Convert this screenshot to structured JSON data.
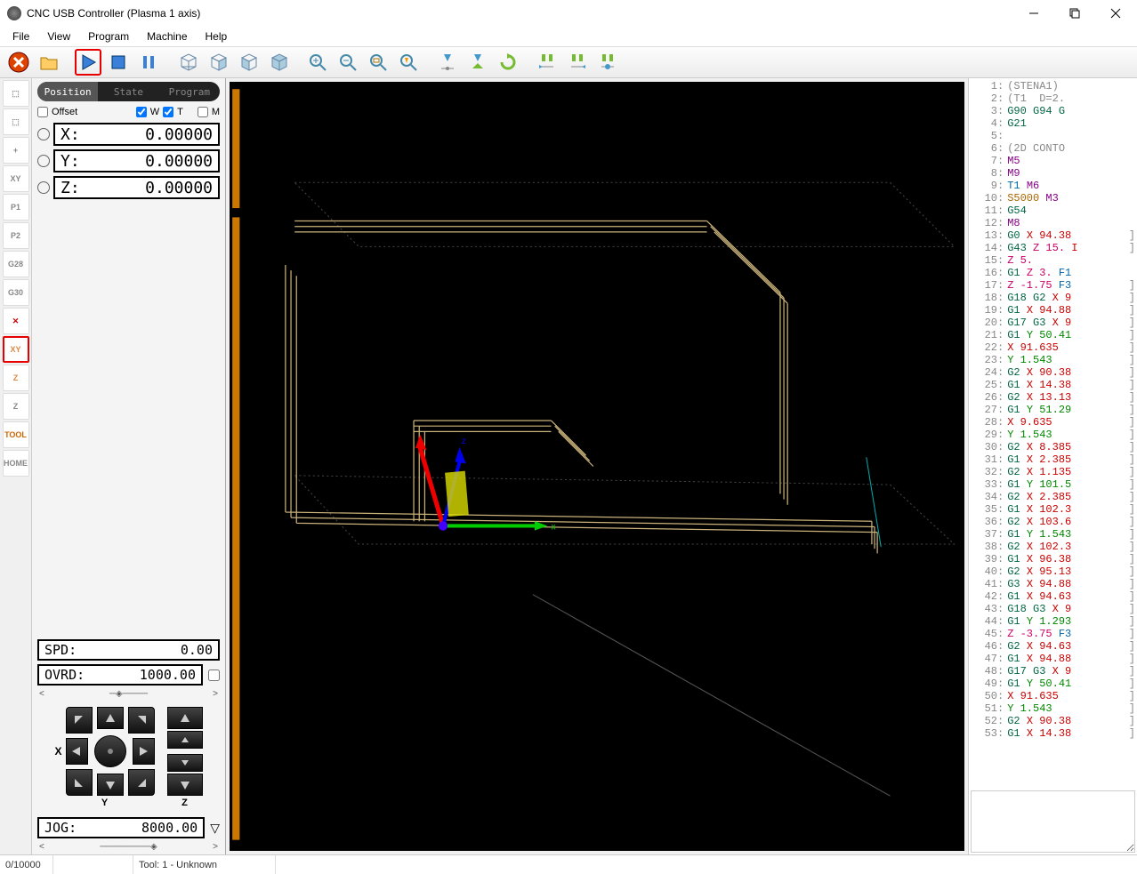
{
  "window": {
    "title": "CNC USB Controller (Plasma 1 axis)"
  },
  "menu": [
    "File",
    "View",
    "Program",
    "Machine",
    "Help"
  ],
  "tabs": {
    "position": "Position",
    "state": "State",
    "program": "Program"
  },
  "offset": {
    "label": "Offset",
    "w": "W",
    "t": "T",
    "m": "M"
  },
  "coords": {
    "x": {
      "axis": "X:",
      "val": "0.00000"
    },
    "y": {
      "axis": "Y:",
      "val": "0.00000"
    },
    "z": {
      "axis": "Z:",
      "val": "0.00000"
    }
  },
  "spd": {
    "label": "SPD:",
    "val": "0.00"
  },
  "ovrd": {
    "label": "OVRD:",
    "val": "1000.00"
  },
  "jog": {
    "label": "JOG:",
    "val": "8000.00",
    "xlabel": "X",
    "ylabel": "Y",
    "zlabel": "Z"
  },
  "rail": [
    "",
    "",
    "+",
    "XY",
    "P1",
    "P2",
    "G28",
    "G30",
    "✕",
    "XY",
    "Z",
    "Z",
    "TOOL",
    "HOME"
  ],
  "status": {
    "left": "0/10000",
    "tool": "Tool: 1 - Unknown"
  },
  "gcode": [
    {
      "n": 1,
      "t": [
        [
          "paren",
          "(STENA1)"
        ]
      ]
    },
    {
      "n": 2,
      "t": [
        [
          "paren",
          "(T1  D=2."
        ]
      ]
    },
    {
      "n": 3,
      "t": [
        [
          "g",
          "G90 G94 G"
        ]
      ]
    },
    {
      "n": 4,
      "t": [
        [
          "g",
          "G21"
        ]
      ]
    },
    {
      "n": 5,
      "t": []
    },
    {
      "n": 6,
      "t": [
        [
          "paren",
          "(2D CONTO"
        ]
      ]
    },
    {
      "n": 7,
      "t": [
        [
          "m",
          "M5"
        ]
      ]
    },
    {
      "n": 8,
      "t": [
        [
          "m",
          "M9"
        ]
      ]
    },
    {
      "n": 9,
      "t": [
        [
          "t",
          "T1 "
        ],
        [
          "m",
          "M6"
        ]
      ]
    },
    {
      "n": 10,
      "t": [
        [
          "s",
          "S5000 "
        ],
        [
          "m",
          "M3"
        ]
      ]
    },
    {
      "n": 11,
      "t": [
        [
          "g",
          "G54"
        ]
      ]
    },
    {
      "n": 12,
      "t": [
        [
          "m",
          "M8"
        ]
      ]
    },
    {
      "n": 13,
      "t": [
        [
          "g",
          "G0 "
        ],
        [
          "x",
          "X 94.38"
        ]
      ],
      "br": true
    },
    {
      "n": 14,
      "t": [
        [
          "g",
          "G43 "
        ],
        [
          "z",
          "Z 15."
        ],
        [
          "x",
          " I"
        ]
      ],
      "br": true
    },
    {
      "n": 15,
      "t": [
        [
          "z",
          "Z 5."
        ]
      ]
    },
    {
      "n": 16,
      "t": [
        [
          "g",
          "G1 "
        ],
        [
          "z",
          "Z 3. "
        ],
        [
          "f",
          "F1"
        ]
      ]
    },
    {
      "n": 17,
      "t": [
        [
          "z",
          "Z -1.75 "
        ],
        [
          "f",
          "F3"
        ]
      ],
      "br": true
    },
    {
      "n": 18,
      "t": [
        [
          "g",
          "G18 G2 "
        ],
        [
          "x",
          "X 9"
        ]
      ],
      "br": true
    },
    {
      "n": 19,
      "t": [
        [
          "g",
          "G1 "
        ],
        [
          "x",
          "X 94.88"
        ]
      ],
      "br": true
    },
    {
      "n": 20,
      "t": [
        [
          "g",
          "G17 G3 "
        ],
        [
          "x",
          "X 9"
        ]
      ],
      "br": true
    },
    {
      "n": 21,
      "t": [
        [
          "g",
          "G1 "
        ],
        [
          "y",
          "Y 50.41"
        ]
      ],
      "br": true
    },
    {
      "n": 22,
      "t": [
        [
          "x",
          "X 91.635"
        ]
      ],
      "br": true
    },
    {
      "n": 23,
      "t": [
        [
          "y",
          "Y 1.543"
        ]
      ],
      "br": true
    },
    {
      "n": 24,
      "t": [
        [
          "g",
          "G2 "
        ],
        [
          "x",
          "X 90.38"
        ]
      ],
      "br": true
    },
    {
      "n": 25,
      "t": [
        [
          "g",
          "G1 "
        ],
        [
          "x",
          "X 14.38"
        ]
      ],
      "br": true
    },
    {
      "n": 26,
      "t": [
        [
          "g",
          "G2 "
        ],
        [
          "x",
          "X 13.13"
        ]
      ],
      "br": true
    },
    {
      "n": 27,
      "t": [
        [
          "g",
          "G1 "
        ],
        [
          "y",
          "Y 51.29"
        ]
      ],
      "br": true
    },
    {
      "n": 28,
      "t": [
        [
          "x",
          "X 9.635"
        ]
      ],
      "br": true
    },
    {
      "n": 29,
      "t": [
        [
          "y",
          "Y 1.543"
        ]
      ],
      "br": true
    },
    {
      "n": 30,
      "t": [
        [
          "g",
          "G2 "
        ],
        [
          "x",
          "X 8.385"
        ]
      ],
      "br": true
    },
    {
      "n": 31,
      "t": [
        [
          "g",
          "G1 "
        ],
        [
          "x",
          "X 2.385"
        ]
      ],
      "br": true
    },
    {
      "n": 32,
      "t": [
        [
          "g",
          "G2 "
        ],
        [
          "x",
          "X 1.135"
        ]
      ],
      "br": true
    },
    {
      "n": 33,
      "t": [
        [
          "g",
          "G1 "
        ],
        [
          "y",
          "Y 101.5"
        ]
      ],
      "br": true
    },
    {
      "n": 34,
      "t": [
        [
          "g",
          "G2 "
        ],
        [
          "x",
          "X 2.385"
        ]
      ],
      "br": true
    },
    {
      "n": 35,
      "t": [
        [
          "g",
          "G1 "
        ],
        [
          "x",
          "X 102.3"
        ]
      ],
      "br": true
    },
    {
      "n": 36,
      "t": [
        [
          "g",
          "G2 "
        ],
        [
          "x",
          "X 103.6"
        ]
      ],
      "br": true
    },
    {
      "n": 37,
      "t": [
        [
          "g",
          "G1 "
        ],
        [
          "y",
          "Y 1.543"
        ]
      ],
      "br": true
    },
    {
      "n": 38,
      "t": [
        [
          "g",
          "G2 "
        ],
        [
          "x",
          "X 102.3"
        ]
      ],
      "br": true
    },
    {
      "n": 39,
      "t": [
        [
          "g",
          "G1 "
        ],
        [
          "x",
          "X 96.38"
        ]
      ],
      "br": true
    },
    {
      "n": 40,
      "t": [
        [
          "g",
          "G2 "
        ],
        [
          "x",
          "X 95.13"
        ]
      ],
      "br": true
    },
    {
      "n": 41,
      "t": [
        [
          "g",
          "G3 "
        ],
        [
          "x",
          "X 94.88"
        ]
      ],
      "br": true
    },
    {
      "n": 42,
      "t": [
        [
          "g",
          "G1 "
        ],
        [
          "x",
          "X 94.63"
        ]
      ],
      "br": true
    },
    {
      "n": 43,
      "t": [
        [
          "g",
          "G18 G3 "
        ],
        [
          "x",
          "X 9"
        ]
      ],
      "br": true
    },
    {
      "n": 44,
      "t": [
        [
          "g",
          "G1 "
        ],
        [
          "y",
          "Y 1.293"
        ]
      ],
      "br": true
    },
    {
      "n": 45,
      "t": [
        [
          "z",
          "Z -3.75 "
        ],
        [
          "f",
          "F3"
        ]
      ],
      "br": true
    },
    {
      "n": 46,
      "t": [
        [
          "g",
          "G2 "
        ],
        [
          "x",
          "X 94.63"
        ]
      ],
      "br": true
    },
    {
      "n": 47,
      "t": [
        [
          "g",
          "G1 "
        ],
        [
          "x",
          "X 94.88"
        ]
      ],
      "br": true
    },
    {
      "n": 48,
      "t": [
        [
          "g",
          "G17 G3 "
        ],
        [
          "x",
          "X 9"
        ]
      ],
      "br": true
    },
    {
      "n": 49,
      "t": [
        [
          "g",
          "G1 "
        ],
        [
          "y",
          "Y 50.41"
        ]
      ],
      "br": true
    },
    {
      "n": 50,
      "t": [
        [
          "x",
          "X 91.635"
        ]
      ],
      "br": true
    },
    {
      "n": 51,
      "t": [
        [
          "y",
          "Y 1.543"
        ]
      ],
      "br": true
    },
    {
      "n": 52,
      "t": [
        [
          "g",
          "G2 "
        ],
        [
          "x",
          "X 90.38"
        ]
      ],
      "br": true
    },
    {
      "n": 53,
      "t": [
        [
          "g",
          "G1 "
        ],
        [
          "x",
          "X 14.38"
        ]
      ],
      "br": true
    }
  ]
}
